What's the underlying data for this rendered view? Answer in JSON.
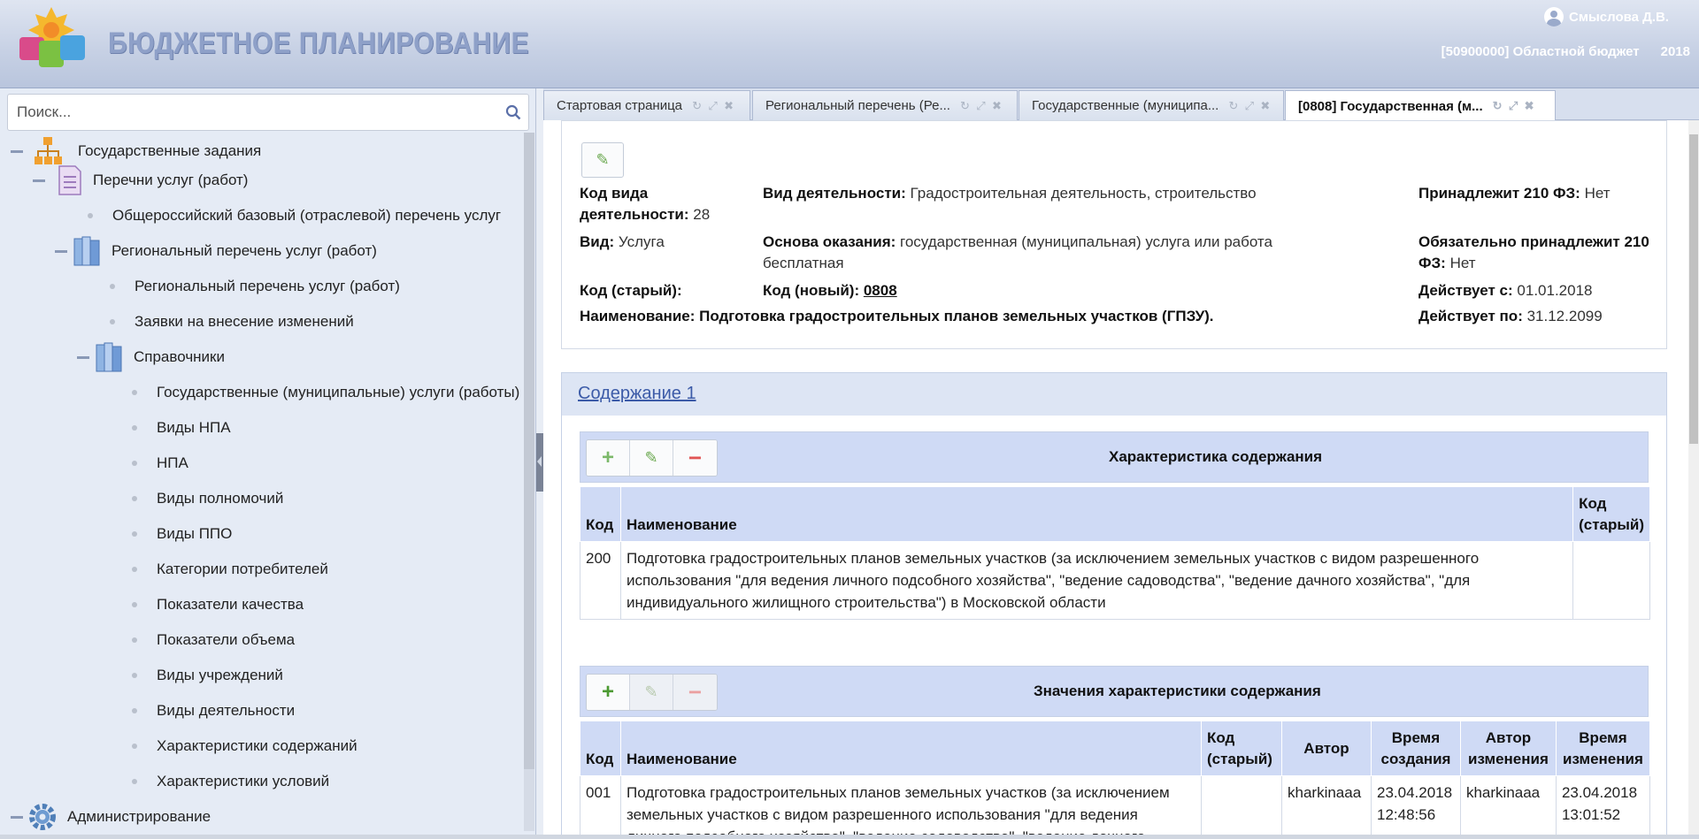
{
  "header": {
    "app_title": "БЮДЖЕТНОЕ ПЛАНИРОВАНИЕ",
    "user_name": "Смыслова Д.В.",
    "budget": "[50900000] Областной бюджет",
    "year": "2018"
  },
  "sidebar": {
    "search_placeholder": "Поиск...",
    "items": [
      {
        "label": "Государственные задания"
      },
      {
        "label": "Перечни услуг (работ)"
      },
      {
        "label": "Общероссийский базовый (отраслевой) перечень услуг"
      },
      {
        "label": "Региональный перечень услуг (работ)"
      },
      {
        "label": "Региональный перечень услуг (работ)"
      },
      {
        "label": "Заявки на внесение изменений"
      },
      {
        "label": "Справочники"
      },
      {
        "label": "Государственные (муниципальные) услуги (работы)"
      },
      {
        "label": "Виды НПА"
      },
      {
        "label": "НПА"
      },
      {
        "label": "Виды полномочий"
      },
      {
        "label": "Виды ППО"
      },
      {
        "label": "Категории потребителей"
      },
      {
        "label": "Показатели качества"
      },
      {
        "label": "Показатели объема"
      },
      {
        "label": "Виды учреждений"
      },
      {
        "label": "Виды деятельности"
      },
      {
        "label": "Характеристики содержаний"
      },
      {
        "label": "Характеристики условий"
      },
      {
        "label": "Администрирование"
      }
    ]
  },
  "tabs": [
    {
      "label": "Стартовая страница"
    },
    {
      "label": "Региональный перечень (Ре..."
    },
    {
      "label": "Государственные (муниципа..."
    },
    {
      "label": "[0808] Государственная (м..."
    }
  ],
  "record": {
    "activity_type_code_label": "Код вида деятельности:",
    "activity_type_code_value": "28",
    "activity_label": "Вид деятельности:",
    "activity_value": "Градостроительная деятельность, строительство",
    "fz210_label": "Принадлежит 210 ФЗ:",
    "fz210_value": "Нет",
    "kind_label": "Вид:",
    "kind_value": "Услуга",
    "basis_label": "Основа оказания:",
    "basis_value": "государственная (муниципальная) услуга или работа бесплатная",
    "fz210_required_label": "Обязательно принадлежит 210 ФЗ:",
    "fz210_required_value": "Нет",
    "old_code_label": "Код (старый):",
    "new_code_label": "Код (новый):",
    "new_code_value": "0808",
    "valid_from_label": "Действует с:",
    "valid_from_value": "01.01.2018",
    "name_label": "Наименование:",
    "name_value": "Подготовка градостроительных планов земельных участков (ГПЗУ).",
    "valid_to_label": "Действует по:",
    "valid_to_value": "31.12.2099"
  },
  "section": {
    "title": "Содержание 1",
    "table1": {
      "title": "Характеристика содержания",
      "headers": [
        "Код",
        "Наименование",
        "Код (старый)"
      ],
      "rows": [
        {
          "code": "200",
          "name": "Подготовка градостроительных планов земельных участков (за исключением земельных участков с видом разрешенного использования \"для ведения личного подсобного хозяйства\", \"ведение садоводства\", \"ведение дачного хозяйства\", \"для индивидуального жилищного строительства\") в Московской области",
          "old_code": ""
        }
      ]
    },
    "table2": {
      "title": "Значения характеристики содержания",
      "headers": [
        "Код",
        "Наименование",
        "Код (старый)",
        "Автор",
        "Время создания",
        "Автор изменения",
        "Время изменения"
      ],
      "rows": [
        {
          "code": "001",
          "name": "Подготовка градостроительных планов земельных участков (за исключением земельных участков с видом разрешенного использования \"для ведения личного подсобного хозяйства\", \"ведение садоводства\", \"ведение дачного",
          "old_code": "",
          "author": "kharkinaaa",
          "created": "23.04.2018 12:48:56",
          "modifier": "kharkinaaa",
          "modified": "23.04.2018 13:01:52"
        }
      ]
    }
  },
  "colors": {
    "accent": "#3c5ba8",
    "header_band": "#cfdaf5",
    "add_green": "#6aa84f",
    "delete_red": "#e05555"
  }
}
